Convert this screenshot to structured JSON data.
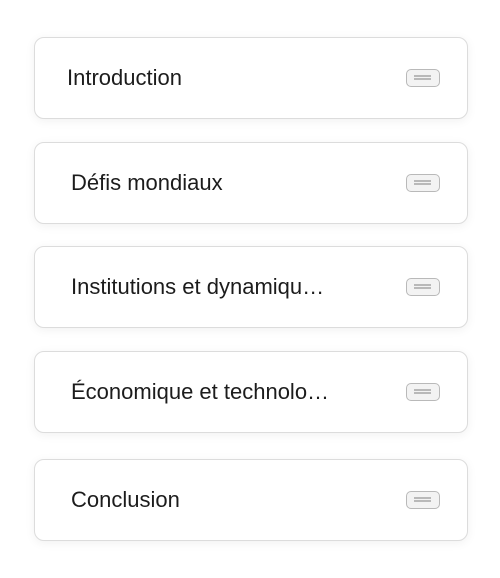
{
  "sections": [
    {
      "label": "Introduction",
      "icon": "drag-handle-icon"
    },
    {
      "label": "Défis mondiaux",
      "icon": "drag-handle-icon"
    },
    {
      "label": "Institutions et dynamiqu…",
      "icon": "drag-handle-icon"
    },
    {
      "label": "Économique et technolo…",
      "icon": "drag-handle-icon"
    },
    {
      "label": "Conclusion",
      "icon": "drag-handle-icon"
    }
  ],
  "colors": {
    "card_border": "#dcdcdc",
    "text": "#1c1c1c",
    "handle_border": "#b9b9b9",
    "handle_fill": "#f3f3f3"
  }
}
